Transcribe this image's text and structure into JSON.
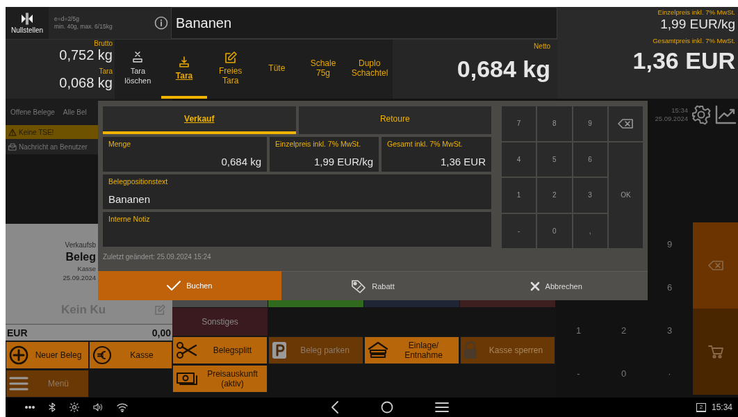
{
  "scale": {
    "zero_button": "Nullstellen",
    "spec_lines": [
      "e=d=2/5g",
      "min. 40g, max. 6/15kg"
    ]
  },
  "article": {
    "title": "Bananen"
  },
  "weights": {
    "gross_label": "Brutto",
    "gross": "0,752 kg",
    "tare_label": "Tara",
    "tare": "0,068 kg"
  },
  "tare_options": [
    {
      "kind": "clear",
      "label": "Tara löschen",
      "selected": false
    },
    {
      "kind": "tare",
      "label": "Tara",
      "selected": true
    },
    {
      "kind": "free",
      "label": "Freies Tara",
      "selected": false
    },
    {
      "kind": "preset",
      "label": "Tüte",
      "selected": false
    },
    {
      "kind": "preset",
      "label": "Schale 75g",
      "selected": false
    },
    {
      "kind": "preset",
      "label": "Duplo Schachtel",
      "selected": false
    }
  ],
  "net": {
    "label": "Netto",
    "value": "0,684 kg"
  },
  "price": {
    "unit_label": "Einzelpreis inkl. 7% MwSt.",
    "unit_value": "1,99 EUR/kg",
    "total_label": "Gesamtpreis inkl. 7% MwSt.",
    "total_value": "1,36 EUR"
  },
  "receipt_tabs": [
    {
      "label": "Offene Belege"
    },
    {
      "label": "Alle Bel"
    }
  ],
  "alerts": [
    {
      "kind": "warning",
      "text": "Keine TSE!"
    },
    {
      "kind": "message",
      "text": "Nachricht an Benutzer"
    }
  ],
  "receipt": {
    "type_line": "Verkaufsb",
    "title": "Beleg",
    "register": "Kasse",
    "date": "25.09.2024",
    "customer": "Kein Ku",
    "currency": "EUR",
    "total": "0,00"
  },
  "category_tiles": [
    {
      "color": "#4a4a4a"
    },
    {
      "color": "#2f6a1f"
    },
    {
      "color": "#1f2535"
    },
    {
      "color": "#3e1f20"
    }
  ],
  "other_tile": {
    "label": "Sonstiges",
    "color": "#3a1a1e"
  },
  "left_actions": [
    {
      "kind": "new",
      "label": "Neuer Beleg",
      "disabled": false
    },
    {
      "kind": "cash",
      "label": "Kasse",
      "disabled": false
    },
    {
      "kind": "menu",
      "label": "Menü",
      "disabled": true
    }
  ],
  "center_actions": [
    {
      "kind": "split",
      "label": "Belegsplitt",
      "disabled": false
    },
    {
      "kind": "park",
      "label": "Beleg parken",
      "disabled": true
    },
    {
      "kind": "drawer",
      "label": "Einlage/ Entnahme",
      "disabled": false
    },
    {
      "kind": "lock",
      "label": "Kasse sperren",
      "disabled": true
    },
    {
      "kind": "price",
      "label": "Preisauskunft (aktiv)",
      "disabled": false
    }
  ],
  "clock": {
    "time": "15:34",
    "date": "25.09.2024"
  },
  "keypad": [
    {
      "kind": "digit",
      "label": "9"
    },
    {
      "kind": "backspace"
    },
    {
      "kind": "digit",
      "label": "6"
    },
    {
      "kind": "digit",
      "label": "1"
    },
    {
      "kind": "digit",
      "label": "2"
    },
    {
      "kind": "digit",
      "label": "3"
    },
    {
      "kind": "cart"
    },
    {
      "kind": "digit",
      "label": "-"
    },
    {
      "kind": "digit",
      "label": "0"
    },
    {
      "kind": "digit",
      "label": "·"
    }
  ],
  "dialog": {
    "tabs": [
      {
        "label": "Verkauf",
        "selected": true
      },
      {
        "label": "Retoure",
        "selected": false
      }
    ],
    "fields": [
      {
        "label": "Menge",
        "value": "0,684 kg"
      },
      {
        "label": "Einzelpreis inkl. 7% MwSt.",
        "value": "1,99 EUR/kg"
      },
      {
        "label": "Gesamt inkl. 7% MwSt.",
        "value": "1,36 EUR"
      }
    ],
    "text_fields": [
      {
        "label": "Belegpositionstext",
        "value": "Bananen"
      },
      {
        "label": "Interne Notiz"
      }
    ],
    "modified": "Zuletzt geändert: 25.09.2024 15:24",
    "keys": [
      {
        "kind": "digit",
        "label": "7"
      },
      {
        "kind": "digit",
        "label": "8"
      },
      {
        "kind": "digit",
        "label": "9"
      },
      {
        "kind": "backspace"
      },
      {
        "kind": "digit",
        "label": "4"
      },
      {
        "kind": "digit",
        "label": "5"
      },
      {
        "kind": "digit",
        "label": "6"
      },
      {
        "kind": "digit",
        "label": "1"
      },
      {
        "kind": "digit",
        "label": "2"
      },
      {
        "kind": "digit",
        "label": "3"
      },
      {
        "kind": "ok",
        "label": "OK"
      },
      {
        "kind": "digit",
        "label": "-"
      },
      {
        "kind": "digit",
        "label": "0"
      },
      {
        "kind": "digit",
        "label": ","
      }
    ],
    "buttons": [
      {
        "kind": "book",
        "label": "Buchen"
      },
      {
        "kind": "discount",
        "label": "Rabatt"
      },
      {
        "kind": "cancel",
        "label": "Abbrechen"
      }
    ]
  },
  "status_bar": {
    "badge": "2",
    "time": "15:34"
  }
}
